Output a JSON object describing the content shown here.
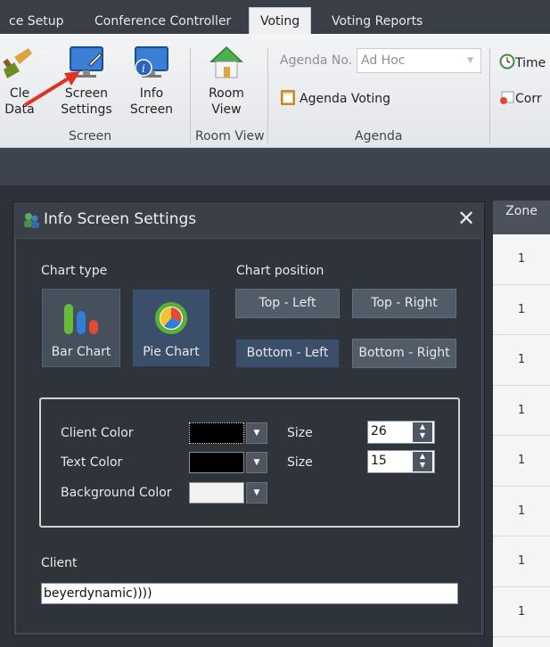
{
  "ribbon": {
    "tabs": [
      "ce Setup",
      "Conference Controller",
      "Voting",
      "Voting Reports"
    ],
    "items": {
      "clear_data": "Cle\nData",
      "screen_settings_1": "Screen",
      "screen_settings_2": "Settings",
      "info_screen_1": "Info",
      "info_screen_2": "Screen",
      "room_view_1": "Room",
      "room_view_2": "View"
    },
    "groups": {
      "screen": "Screen",
      "room_view": "Room View",
      "agenda": "Agenda"
    },
    "agenda_no_label": "Agenda No.",
    "agenda_select_value": "Ad Hoc",
    "agenda_voting": "Agenda Voting",
    "timer_label": "Time",
    "corr_label": "Corr"
  },
  "zone": {
    "header": "Zone",
    "values": [
      "1",
      "1",
      "1",
      "1",
      "1",
      "1",
      "1",
      "1"
    ]
  },
  "dialog": {
    "title": "Info Screen Settings",
    "chart_type_label": "Chart type",
    "chart_position_label": "Chart position",
    "bar_chart": "Bar Chart",
    "pie_chart": "Pie Chart",
    "top_left": "Top - Left",
    "top_right": "Top - Right",
    "bottom_left": "Bottom - Left",
    "bottom_right": "Bottom - Right",
    "client_color_label": "Client Color",
    "text_color_label": "Text Color",
    "background_color_label": "Background Color",
    "size_label": "Size",
    "client_size": "26",
    "text_size": "15",
    "client_label": "Client",
    "client_value": "beyerdynamic))))",
    "colors": {
      "client": "#000000",
      "text": "#000000",
      "background": "#f2f2f2"
    }
  }
}
